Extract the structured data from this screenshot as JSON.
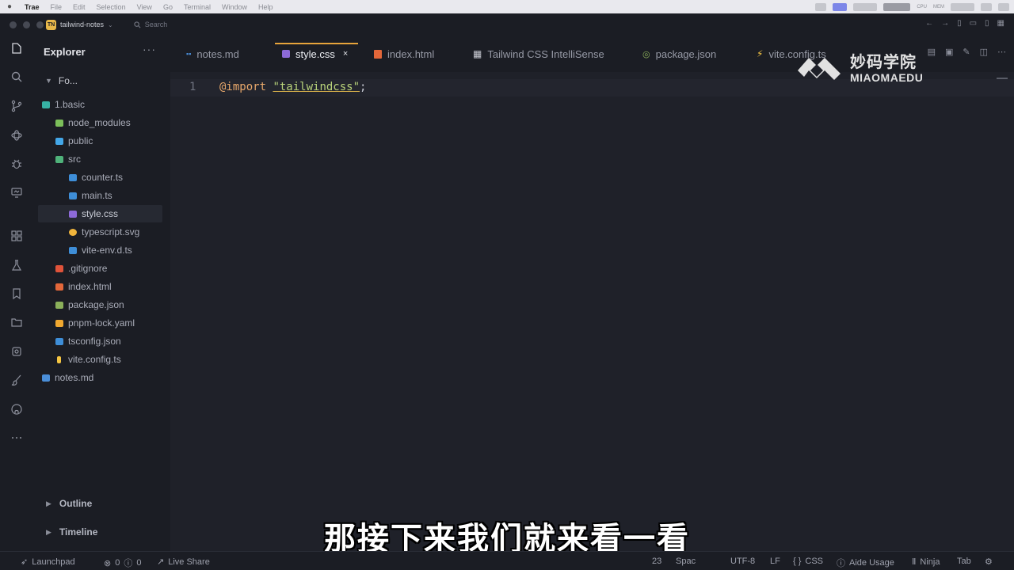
{
  "menubar": {
    "app": "Trae",
    "items": [
      "File",
      "Edit",
      "Selection",
      "View",
      "Go",
      "Terminal",
      "Window",
      "Help"
    ],
    "tray": [
      "CPU",
      "MEM"
    ]
  },
  "titlebar": {
    "badge": "TN",
    "project": "tailwind-notes",
    "search": "Search"
  },
  "sidebar": {
    "title": "Explorer",
    "more": "···",
    "folder": "Fo...",
    "tree": [
      {
        "label": "1.basic",
        "depth": 0,
        "icon": "folder-open-icon",
        "color": "#37b1a4"
      },
      {
        "label": "node_modules",
        "depth": 1,
        "icon": "folder-node-icon",
        "color": "#7cbf5a"
      },
      {
        "label": "public",
        "depth": 1,
        "icon": "folder-public-icon",
        "color": "#43a7e8"
      },
      {
        "label": "src",
        "depth": 1,
        "icon": "folder-src-icon",
        "color": "#4fb27a"
      },
      {
        "label": "counter.ts",
        "depth": 2,
        "icon": "ts-file-icon",
        "color": "#3e8ed8"
      },
      {
        "label": "main.ts",
        "depth": 2,
        "icon": "ts-file-icon",
        "color": "#3e8ed8"
      },
      {
        "label": "style.css",
        "depth": 2,
        "icon": "css-file-icon",
        "color": "#8d6ad8",
        "selected": true
      },
      {
        "label": "typescript.svg",
        "depth": 2,
        "icon": "svg-file-icon",
        "color": "#f0b43c"
      },
      {
        "label": "vite-env.d.ts",
        "depth": 2,
        "icon": "ts-file-icon",
        "color": "#3e8ed8"
      },
      {
        "label": ".gitignore",
        "depth": 1,
        "icon": "git-file-icon",
        "color": "#e0533a"
      },
      {
        "label": "index.html",
        "depth": 1,
        "icon": "html-file-icon",
        "color": "#e3673a"
      },
      {
        "label": "package.json",
        "depth": 1,
        "icon": "npm-file-icon",
        "color": "#8bb05a"
      },
      {
        "label": "pnpm-lock.yaml",
        "depth": 1,
        "icon": "pnpm-file-icon",
        "color": "#f0a830"
      },
      {
        "label": "tsconfig.json",
        "depth": 1,
        "icon": "ts-config-icon",
        "color": "#3e8ed8"
      },
      {
        "label": "vite.config.ts",
        "depth": 1,
        "icon": "vite-file-icon",
        "color": "#f5c542"
      },
      {
        "label": "notes.md",
        "depth": 0,
        "icon": "md-file-icon",
        "color": "#4a8ed8"
      }
    ],
    "sections": [
      "Outline",
      "Timeline"
    ]
  },
  "tabs": [
    {
      "label": "notes.md",
      "icon": "md-file-icon",
      "color": "#4a8ed8"
    },
    {
      "label": "style.css",
      "icon": "css-file-icon",
      "color": "#8d6ad8",
      "active": true,
      "close": "×"
    },
    {
      "label": "index.html",
      "icon": "html-file-icon",
      "color": "#e3673a"
    },
    {
      "label": "Tailwind CSS IntelliSense",
      "icon": "extension-icon",
      "color": "#c8cad2"
    },
    {
      "label": "package.json",
      "icon": "npm-file-icon",
      "color": "#8bb05a"
    },
    {
      "label": "vite.config.ts",
      "icon": "vite-file-icon",
      "color": "#f5c542"
    }
  ],
  "editor": {
    "line_number": "1",
    "keyword": "@import",
    "string": "\"tailwindcss\"",
    "punct": ";"
  },
  "watermark": {
    "cn": "妙码学院",
    "en": "MIAOMAEDU"
  },
  "subtitle": "那接下来我们就来看一看",
  "statusbar": {
    "launchpad": "Launchpad",
    "errors": "0",
    "warnings": "0",
    "live_share": "Live Share",
    "col": "23",
    "spaces": "Spac",
    "encoding": "UTF-8",
    "eol": "LF",
    "lang_braces": "{ }",
    "language": "CSS",
    "aide": "Aide Usage",
    "ninja": "Ninja",
    "tab": "Tab"
  }
}
